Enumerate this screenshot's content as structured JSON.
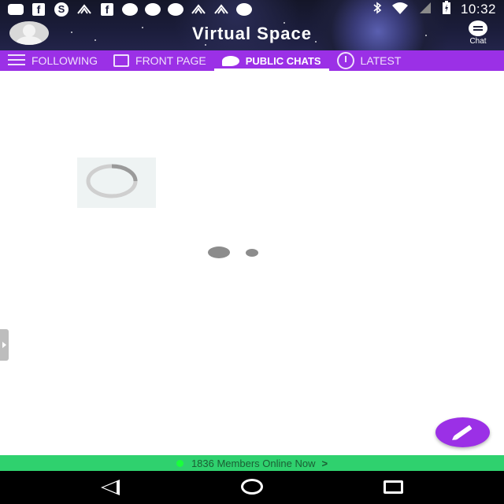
{
  "status_bar": {
    "time": "10:32",
    "icons": [
      "message-icon",
      "facebook-icon",
      "s-app-icon",
      "app-icon",
      "facebook-icon",
      "circle-icon",
      "circle-icon",
      "circle-icon",
      "app-icon",
      "app-icon",
      "circle-icon",
      "bluetooth-icon",
      "wifi-icon",
      "no-signal-icon",
      "battery-icon"
    ]
  },
  "header": {
    "title": "Virtual Space",
    "chat_label": "Chat"
  },
  "tabs": [
    {
      "label": "FOLLOWING",
      "icon": "list-icon",
      "active": false
    },
    {
      "label": "FRONT PAGE",
      "icon": "document-icon",
      "active": false
    },
    {
      "label": "PUBLIC CHATS",
      "icon": "chat-bubbles-icon",
      "active": true
    },
    {
      "label": "LATEST",
      "icon": "clock-icon",
      "active": false
    }
  ],
  "online_bar": {
    "text": "1836 Members Online Now",
    "arrow": ">"
  },
  "colors": {
    "accent": "#9b30e6",
    "online_bar": "#2fd16e"
  }
}
